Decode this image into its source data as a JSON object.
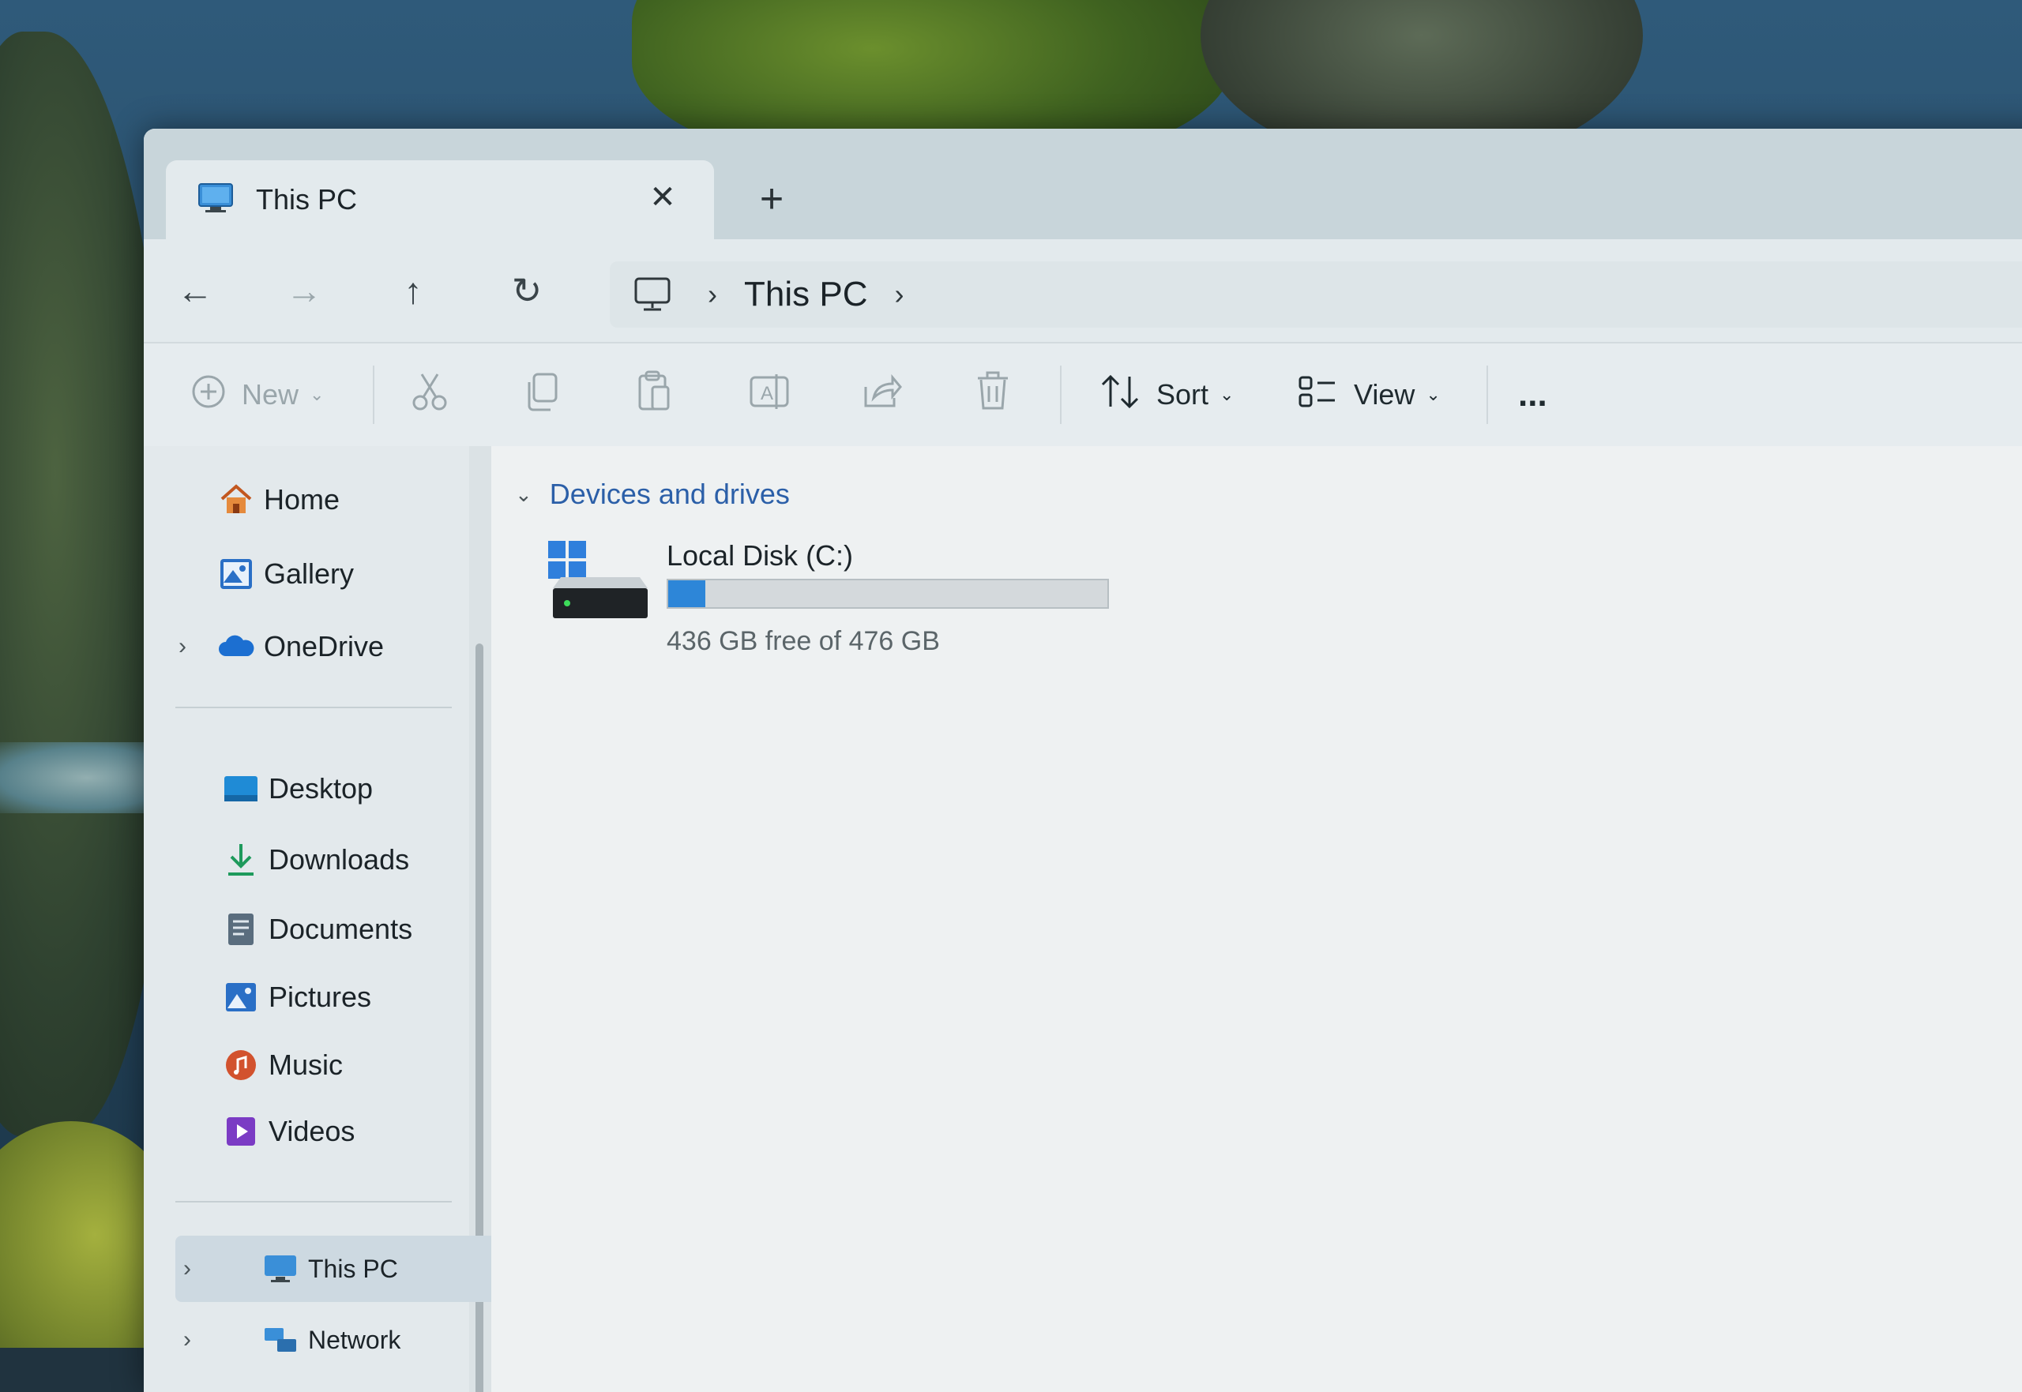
{
  "window": {
    "tab_title": "This PC",
    "tab_icon": "monitor-icon",
    "new_tab_label": "+"
  },
  "nav": {
    "back_icon": "arrow-left-icon",
    "forward_icon": "arrow-right-icon",
    "up_icon": "arrow-up-icon",
    "refresh_icon": "refresh-icon",
    "breadcrumb": [
      "This PC"
    ]
  },
  "toolbar": {
    "new_label": "New",
    "sort_label": "Sort",
    "view_label": "View",
    "more_label": "..."
  },
  "sidebar": {
    "top_items": [
      {
        "label": "Home",
        "icon": "home-icon"
      },
      {
        "label": "Gallery",
        "icon": "gallery-icon"
      },
      {
        "label": "OneDrive",
        "icon": "cloud-icon"
      }
    ],
    "pinned_items": [
      {
        "label": "Desktop",
        "icon": "desktop-folder-icon"
      },
      {
        "label": "Downloads",
        "icon": "download-icon"
      },
      {
        "label": "Documents",
        "icon": "documents-icon"
      },
      {
        "label": "Pictures",
        "icon": "pictures-icon"
      },
      {
        "label": "Music",
        "icon": "music-icon"
      },
      {
        "label": "Videos",
        "icon": "videos-icon"
      }
    ],
    "bottom_items": [
      {
        "label": "This PC",
        "icon": "monitor-icon",
        "selected": true
      },
      {
        "label": "Network",
        "icon": "network-icon"
      }
    ]
  },
  "content": {
    "group_title": "Devices and drives",
    "drives": [
      {
        "name": "Local Disk (C:)",
        "free_text": "436 GB free of 476 GB",
        "used_fraction": 0.084
      }
    ]
  },
  "colors": {
    "accent": "#2d86d8",
    "group_header": "#2b5fa8"
  }
}
